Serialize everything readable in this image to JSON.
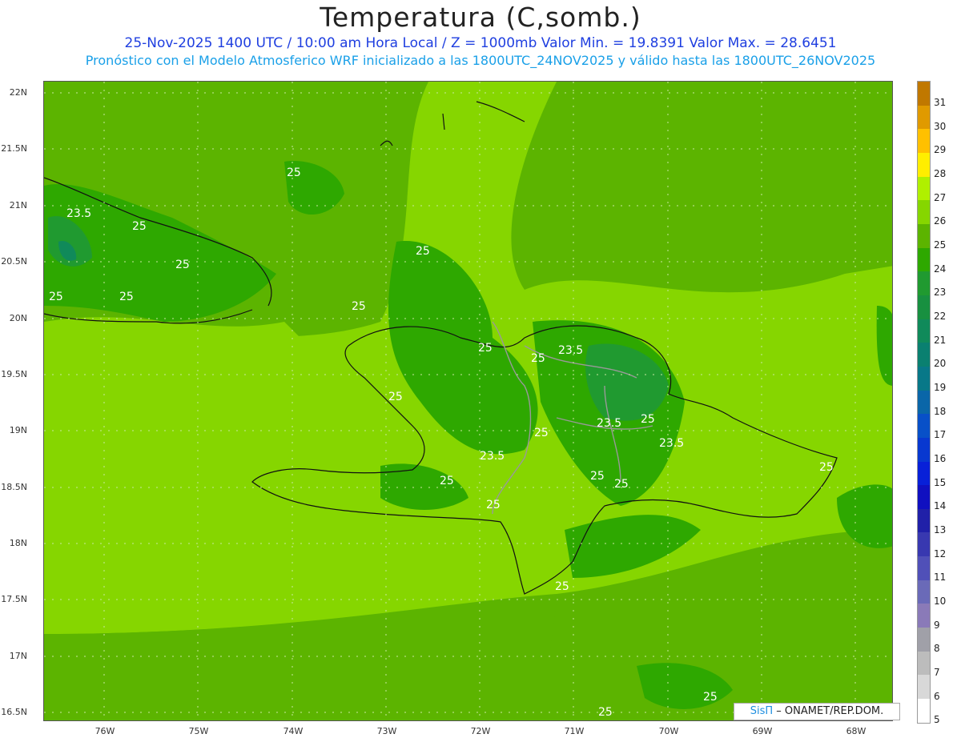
{
  "title": "Temperatura (C,somb.)",
  "subtitle1": "25-Nov-2025 1400 UTC / 10:00 am Hora Local / Z = 1000mb  Valor Min. = 19.8391  Valor Max. = 28.6451",
  "subtitle2": "Pronóstico con el Modelo Atmosferico WRF inicializado a las 1800UTC_24NOV2025 y válido hasta las  1800UTC_26NOV2025",
  "lat_labels": [
    "22N",
    "21.5N",
    "21N",
    "20.5N",
    "20N",
    "19.5N",
    "19N",
    "18.5N",
    "18N",
    "17.5N",
    "17N",
    "16.5N"
  ],
  "lon_labels": [
    "76W",
    "75W",
    "74W",
    "73W",
    "72W",
    "71W",
    "70W",
    "69W",
    "68W"
  ],
  "colorbar": {
    "levels": [
      "31",
      "30",
      "29",
      "28",
      "27",
      "26",
      "25",
      "24",
      "23",
      "22",
      "21",
      "20",
      "19",
      "18",
      "17",
      "16",
      "15",
      "14",
      "13",
      "12",
      "11",
      "10",
      "9",
      "8",
      "7",
      "6",
      "5"
    ],
    "colors": [
      "#c07800",
      "#e09a00",
      "#ffc000",
      "#ffee00",
      "#b0f000",
      "#86d600",
      "#5cb400",
      "#2ea800",
      "#209a30",
      "#189040",
      "#108a5a",
      "#0a8070",
      "#087888",
      "#0a66a8",
      "#0850c8",
      "#0838d0",
      "#0820d8",
      "#1010c0",
      "#2020a8",
      "#3838b0",
      "#5050b8",
      "#6a6ab8",
      "#8a7ab8",
      "#a0a0a8",
      "#bcbcbc",
      "#d8d8d8",
      "#ffffff"
    ]
  },
  "contour_labels": {
    "l1": "25",
    "l2": "23.5",
    "l3": "25",
    "l4": "25",
    "l5": "25",
    "l6": "25",
    "l7": "25",
    "l8": "25",
    "l9": "25",
    "l10": "25",
    "l11": "23.5",
    "l12": "25",
    "l13": "25",
    "l14": "23.5",
    "l15": "25",
    "l16": "23.5",
    "l17": "23.5",
    "l18": "25",
    "l19": "25",
    "l20": "25",
    "l21": "25",
    "l22": "25",
    "l23": "25",
    "l24": "25",
    "l25": "25",
    "l26": "25"
  },
  "credit": {
    "logo": "SisΠ",
    "text": " – ONAMET/REP.DOM."
  }
}
